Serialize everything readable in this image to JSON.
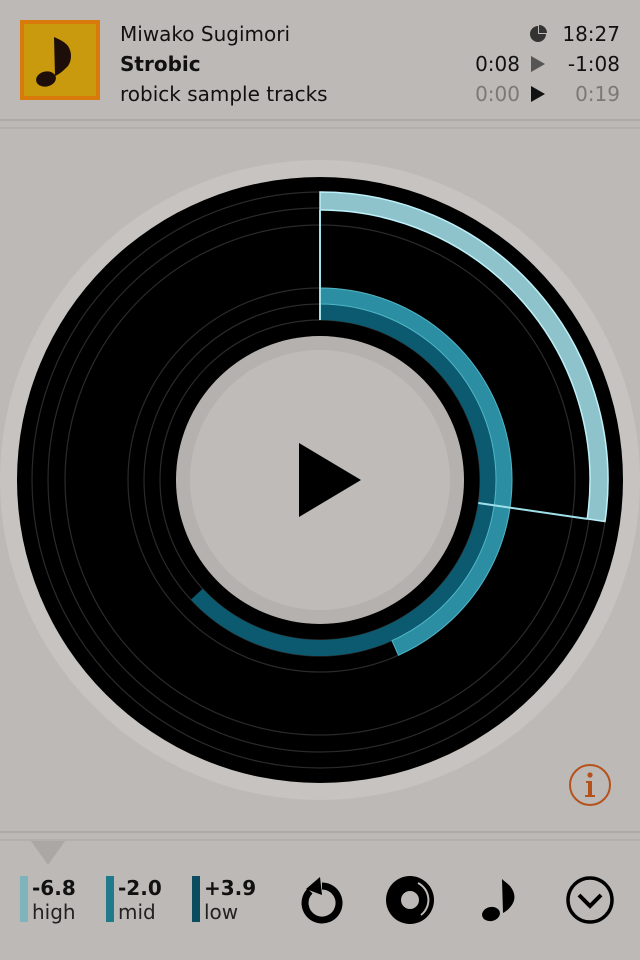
{
  "header": {
    "artist": "Miwako Sugimori",
    "title": "Strobic",
    "album": "robick sample tracks",
    "art_icon": "music-note-icon",
    "clock_icon": "pie-clock-icon",
    "total_time": "18:27",
    "track_elapsed": "0:08",
    "track_remaining": "-1:08",
    "loop_elapsed": "0:00",
    "loop_remaining": "0:19"
  },
  "colors": {
    "background": "#bdb9b6",
    "art_border": "#d87a0a",
    "art_fill": "#c99a0e",
    "high": "#8fc3cc",
    "mid": "#2b8ea2",
    "low": "#0c5a70",
    "info": "#b5521b"
  },
  "visualizer": {
    "high_fraction": 0.273,
    "mid_fraction": 0.433,
    "low_fraction": 0.631
  },
  "eq": [
    {
      "value": "-6.8",
      "label": "high",
      "color": "#7fb4bd"
    },
    {
      "value": "-2.0",
      "label": "mid",
      "color": "#1f7a8a"
    },
    {
      "value": "+3.9",
      "label": "low",
      "color": "#0b4c5e"
    }
  ],
  "toolbar": {
    "buttons": [
      {
        "name": "repeat-button",
        "icon": "rotate-left-icon"
      },
      {
        "name": "disc-button",
        "icon": "disc-icon"
      },
      {
        "name": "music-button",
        "icon": "music-note-icon"
      },
      {
        "name": "collapse-button",
        "icon": "chevron-down-circle-icon"
      }
    ]
  },
  "info_icon": "info-icon"
}
